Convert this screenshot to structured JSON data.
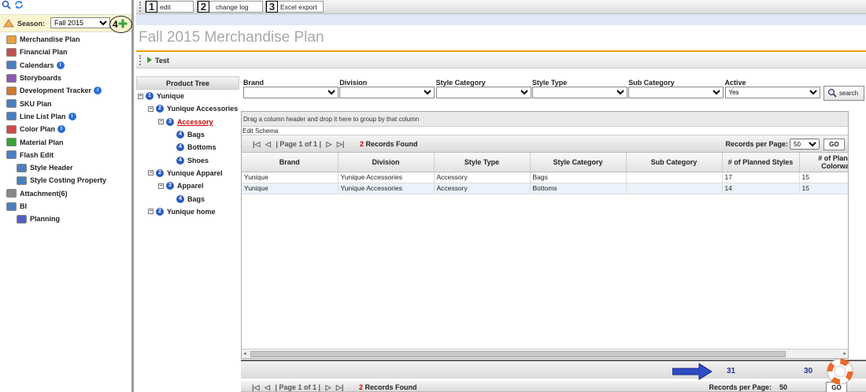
{
  "season": {
    "label": "Season:",
    "value": "Fall 2015",
    "annotation": "4"
  },
  "nav": [
    {
      "label": "Merchandise Plan",
      "level": 0,
      "icon": "merchandise-icon",
      "badge": false
    },
    {
      "label": "Financial Plan",
      "level": 0,
      "icon": "financial-icon",
      "badge": false
    },
    {
      "label": "Calendars",
      "level": 0,
      "icon": "calendar-icon",
      "badge": true
    },
    {
      "label": "Storyboards",
      "level": 0,
      "icon": "storyboard-icon",
      "badge": false
    },
    {
      "label": "Development Tracker",
      "level": 0,
      "icon": "tracker-icon",
      "badge": true
    },
    {
      "label": "SKU Plan",
      "level": 0,
      "icon": "sku-icon",
      "badge": false
    },
    {
      "label": "Line List Plan",
      "level": 0,
      "icon": "linelist-icon",
      "badge": true
    },
    {
      "label": "Color Plan",
      "level": 0,
      "icon": "color-icon",
      "badge": true
    },
    {
      "label": "Material Plan",
      "level": 0,
      "icon": "material-icon",
      "badge": false
    },
    {
      "label": "Flash Edit",
      "level": 0,
      "icon": "flash-edit-icon",
      "badge": false
    },
    {
      "label": "Style Header",
      "level": 1,
      "icon": "grid-icon",
      "badge": false
    },
    {
      "label": "Style Costing Property",
      "level": 1,
      "icon": "grid-icon",
      "badge": false
    },
    {
      "label": "Attachment(6)",
      "level": 0,
      "icon": "paperclip-icon",
      "badge": false
    },
    {
      "label": "BI",
      "level": 0,
      "icon": "bi-icon",
      "badge": false
    },
    {
      "label": "Planning",
      "level": 1,
      "icon": "bar-chart-icon",
      "badge": false
    }
  ],
  "toolbar": {
    "edit_label": "edit",
    "edit_num": "1",
    "changelog_label": "change log",
    "changelog_num": "2",
    "excel_label": "Excel export",
    "excel_num": "3"
  },
  "page_title": "Fall 2015 Merchandise Plan",
  "test_label": "Test",
  "tree": {
    "header": "Product Tree",
    "nodes": [
      {
        "label": "Yunique",
        "level": 1,
        "num": "1",
        "indent": 0
      },
      {
        "label": "Yunique Accessories",
        "level": 2,
        "num": "2",
        "indent": 1
      },
      {
        "label": "Accessory",
        "level": 3,
        "num": "3",
        "indent": 2,
        "selected": true
      },
      {
        "label": "Bags",
        "level": 4,
        "num": "4",
        "indent": 3
      },
      {
        "label": "Bottoms",
        "level": 4,
        "num": "4",
        "indent": 3
      },
      {
        "label": "Shoes",
        "level": 4,
        "num": "4",
        "indent": 3
      },
      {
        "label": "Yunique Apparel",
        "level": 2,
        "num": "2",
        "indent": 1
      },
      {
        "label": "Apparel",
        "level": 3,
        "num": "3",
        "indent": 2
      },
      {
        "label": "Bags",
        "level": 4,
        "num": "4",
        "indent": 3
      },
      {
        "label": "Yunique home",
        "level": 2,
        "num": "2",
        "indent": 1
      }
    ]
  },
  "filters": [
    {
      "label": "Brand",
      "value": ""
    },
    {
      "label": "Division",
      "value": ""
    },
    {
      "label": "Style Category",
      "value": ""
    },
    {
      "label": "Style Type",
      "value": ""
    },
    {
      "label": "Sub Category",
      "value": ""
    },
    {
      "label": "Active",
      "value": "Yes"
    }
  ],
  "search_label": "search",
  "grid": {
    "group_hint": "Drag a column header and drop it here to group by that column",
    "schema_label": "Edit Schema",
    "page_info": "| Page 1 of 1 |",
    "records_count": "2",
    "records_label": "Records Found",
    "rpp_label": "Records per Page:",
    "rpp_value": "50",
    "go_label": "GO",
    "columns": [
      "Brand",
      "Division",
      "Style Type",
      "Style Category",
      "Sub Category",
      "# of Planned Styles",
      "# of Planned Colorways"
    ],
    "rows": [
      [
        "Yunique",
        "Yunique Accessories",
        "Accessory",
        "Bags",
        "",
        "17",
        "15"
      ],
      [
        "Yunique",
        "Yunique Accessories",
        "Accessory",
        "Bottoms",
        "",
        "14",
        "15"
      ]
    ],
    "totals": {
      "planned_styles": "31",
      "planned_colorways": "30"
    }
  }
}
